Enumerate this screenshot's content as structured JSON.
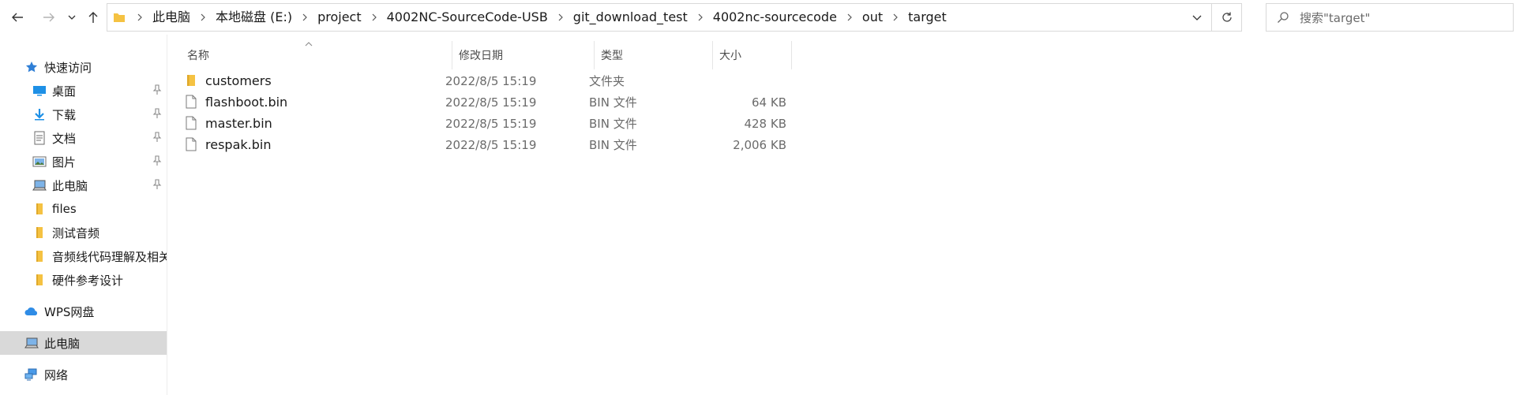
{
  "navigation": {
    "back_icon": "arrow-left-icon",
    "forward_icon": "arrow-right-icon",
    "recent_icon": "chevron-down-icon",
    "up_icon": "arrow-up-icon"
  },
  "address": {
    "breadcrumbs": [
      "此电脑",
      "本地磁盘 (E:)",
      "project",
      "4002NC-SourceCode-USB",
      "git_download_test",
      "4002nc-sourcecode",
      "out",
      "target"
    ]
  },
  "search": {
    "placeholder": "搜索\"target\""
  },
  "sidebar": {
    "quick_access": "快速访问",
    "pinned": [
      {
        "label": "桌面",
        "icon": "desktop-icon"
      },
      {
        "label": "下载",
        "icon": "download-icon"
      },
      {
        "label": "文档",
        "icon": "document-icon"
      },
      {
        "label": "图片",
        "icon": "picture-icon"
      },
      {
        "label": "此电脑",
        "icon": "computer-icon"
      }
    ],
    "folders": [
      {
        "label": "files"
      },
      {
        "label": "测试音频"
      },
      {
        "label": "音频线代码理解及相关"
      },
      {
        "label": "硬件参考设计"
      }
    ],
    "wps": "WPS网盘",
    "this_pc": "此电脑",
    "network": "网络"
  },
  "file_list": {
    "columns": {
      "name": "名称",
      "modified": "修改日期",
      "type": "类型",
      "size": "大小"
    },
    "rows": [
      {
        "name": "customers",
        "modified": "2022/8/5 15:19",
        "type": "文件夹",
        "size": "",
        "kind": "folder"
      },
      {
        "name": "flashboot.bin",
        "modified": "2022/8/5 15:19",
        "type": "BIN 文件",
        "size": "64 KB",
        "kind": "file"
      },
      {
        "name": "master.bin",
        "modified": "2022/8/5 15:19",
        "type": "BIN 文件",
        "size": "428 KB",
        "kind": "file"
      },
      {
        "name": "respak.bin",
        "modified": "2022/8/5 15:19",
        "type": "BIN 文件",
        "size": "2,006 KB",
        "kind": "file"
      }
    ]
  },
  "colors": {
    "folder": "#f5c242",
    "accent": "#0078d4",
    "selected_bg": "#d9d9d9"
  }
}
